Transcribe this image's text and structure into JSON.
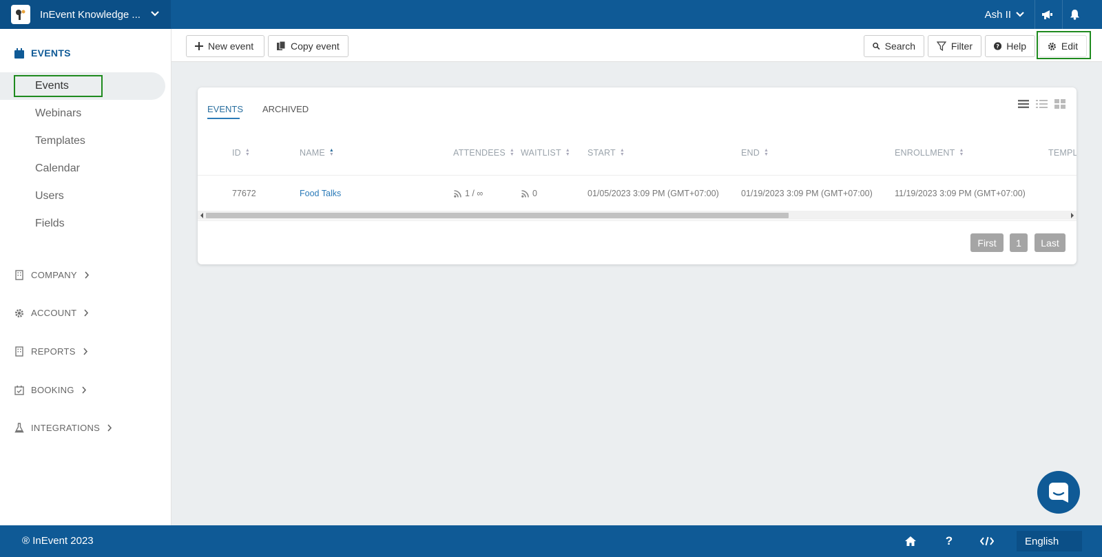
{
  "brand": {
    "name": "InEvent Knowledge ..."
  },
  "user": {
    "name": "Ash II"
  },
  "sidebar": {
    "events_section": "EVENTS",
    "items": [
      {
        "label": "Events",
        "active": true
      },
      {
        "label": "Webinars"
      },
      {
        "label": "Templates"
      },
      {
        "label": "Calendar"
      },
      {
        "label": "Users"
      },
      {
        "label": "Fields"
      }
    ],
    "sections": [
      {
        "label": "COMPANY",
        "icon": "building-icon"
      },
      {
        "label": "ACCOUNT",
        "icon": "gear-icon"
      },
      {
        "label": "REPORTS",
        "icon": "building-icon"
      },
      {
        "label": "BOOKING",
        "icon": "calendar-check-icon"
      },
      {
        "label": "INTEGRATIONS",
        "icon": "flask-icon"
      }
    ]
  },
  "toolbar": {
    "new_event": "New event",
    "copy_event": "Copy event",
    "search": "Search",
    "filter": "Filter",
    "help": "Help",
    "edit": "Edit"
  },
  "tabs": [
    "EVENTS",
    "ARCHIVED"
  ],
  "table": {
    "columns": [
      "ID",
      "NAME",
      "ATTENDEES",
      "WAITLIST",
      "START",
      "END",
      "ENROLLMENT",
      "TEMPL"
    ],
    "rows": [
      {
        "id": "77672",
        "name": "Food Talks",
        "attendees": "1 / ∞",
        "waitlist": "0",
        "start": "01/05/2023 3:09 PM (GMT+07:00)",
        "end": "01/19/2023 3:09 PM (GMT+07:00)",
        "enrollment": "11/19/2023 3:09 PM (GMT+07:00)"
      }
    ]
  },
  "pagination": {
    "first": "First",
    "page": "1",
    "last": "Last"
  },
  "footer": {
    "copyright": "® InEvent 2023",
    "language": "English"
  },
  "colors": {
    "primary": "#0f5a96",
    "highlight": "#1e8a1e",
    "link": "#2a7ab8"
  }
}
